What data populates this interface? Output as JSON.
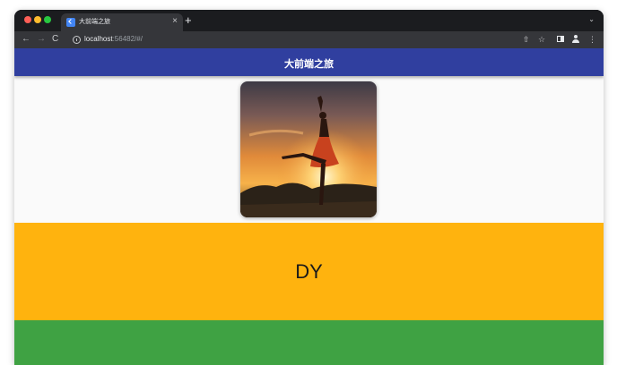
{
  "browser": {
    "tab_title": "大前端之旅",
    "tab_close": "×",
    "new_tab": "+",
    "tab_search": "⌄",
    "url_host": "localhost",
    "url_rest": ":56482/#/",
    "icons": {
      "back": "←",
      "forward": "→",
      "reload": "C",
      "share": "⇧",
      "star": "☆",
      "menu": "⋮"
    }
  },
  "app": {
    "appbar_title": "大前端之旅",
    "appbar_color": "#303f9f",
    "image_alt_subject": "dancer-silhouette-sunset",
    "yellow_text": "DY",
    "yellow_color": "#ffb30e",
    "green_color": "#3fa243"
  }
}
